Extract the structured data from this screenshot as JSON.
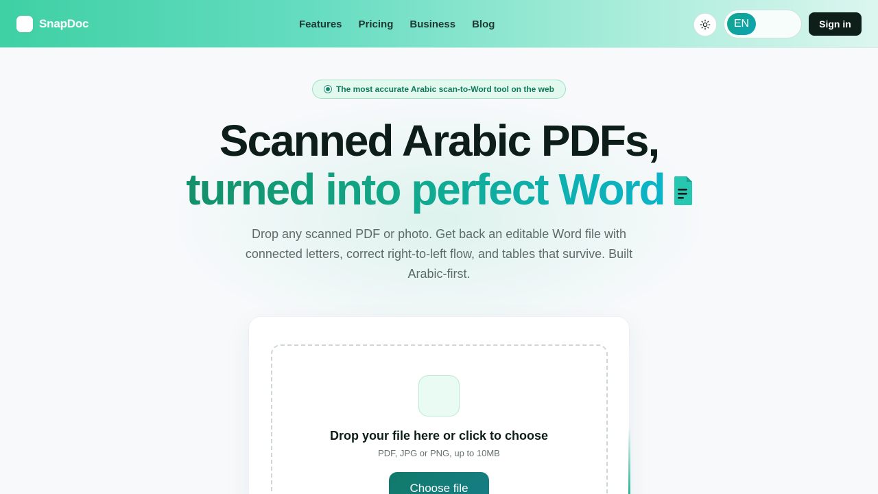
{
  "header": {
    "brand": "SnapDoc",
    "nav": [
      "Features",
      "Pricing",
      "Business",
      "Blog"
    ],
    "lang": "EN",
    "signin_label": "Sign in"
  },
  "hero": {
    "badge": "The most accurate Arabic scan-to-Word tool on the web",
    "title_line1": "Scanned Arabic PDFs,",
    "title_line2": "turned into perfect Word",
    "subtitle": "Drop any scanned PDF or photo. Get back an editable Word file with connected letters, correct right-to-left flow, and tables that survive. Built Arabic-first."
  },
  "upload": {
    "title": "Drop your file here or click to choose",
    "hint": "PDF, JPG or PNG, up to 10MB",
    "button_label": "Choose file"
  },
  "colors": {
    "accent": "#13906a",
    "accent_cyan": "#0bb4c8",
    "dark": "#0e1f1a",
    "header_start": "#3fd0a4"
  },
  "icons": {
    "theme": "sun-icon",
    "title_doc": "document-icon",
    "badge": "status-dot-icon"
  }
}
